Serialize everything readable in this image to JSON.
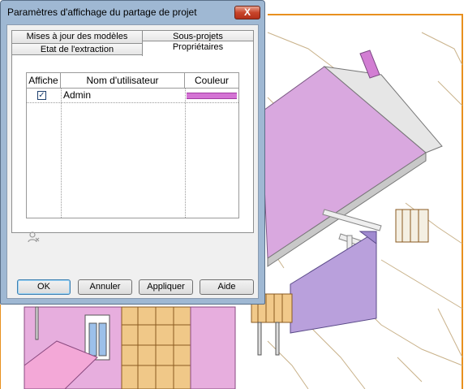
{
  "dialog": {
    "title": "Paramètres d'affichage du partage de projet",
    "close_glyph": "X",
    "tabs_back": [
      "Mises à jour des modèles",
      "Sous-projets"
    ],
    "tabs_front": [
      "Etat de l'extraction",
      "Propriétaires"
    ],
    "active_tab": "Propriétaires",
    "table": {
      "headers": [
        "Affiche",
        "Nom d'utilisateur",
        "Couleur"
      ],
      "rows": [
        {
          "shown": true,
          "check_glyph": "✓",
          "user": "Admin",
          "color": "#d473d4"
        }
      ]
    },
    "buttons": {
      "ok": "OK",
      "cancel": "Annuler",
      "apply": "Appliquer",
      "help": "Aide"
    }
  },
  "background": {
    "description_colors": {
      "roof": "#d9a8df",
      "wall": "#b9a0dc",
      "wood": "#e8b56a",
      "ground_line": "#e8901e"
    }
  }
}
